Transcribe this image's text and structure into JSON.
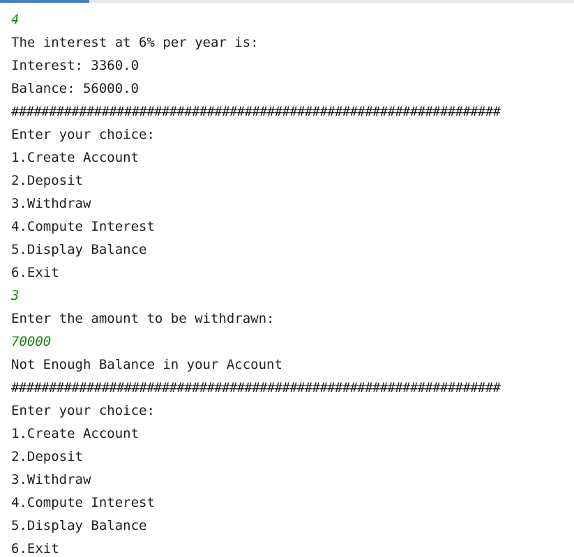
{
  "progress": {
    "fraction": 0.155
  },
  "colors": {
    "input": "#178217",
    "output": "#1f1f1f",
    "progress": "#3d7fd6"
  },
  "console": {
    "lines": [
      {
        "text": "4",
        "type": "input"
      },
      {
        "text": "The interest at 6% per year is:",
        "type": "output"
      },
      {
        "text": "Interest: 3360.0",
        "type": "output"
      },
      {
        "text": "Balance: 56000.0",
        "type": "output"
      },
      {
        "text": "#################################################################",
        "type": "separator"
      },
      {
        "text": "Enter your choice:",
        "type": "output"
      },
      {
        "text": "1.Create Account",
        "type": "output"
      },
      {
        "text": "2.Deposit",
        "type": "output"
      },
      {
        "text": "3.Withdraw",
        "type": "output"
      },
      {
        "text": "4.Compute Interest",
        "type": "output"
      },
      {
        "text": "5.Display Balance",
        "type": "output"
      },
      {
        "text": "6.Exit",
        "type": "output"
      },
      {
        "text": "3",
        "type": "input"
      },
      {
        "text": "Enter the amount to be withdrawn:",
        "type": "output"
      },
      {
        "text": "70000",
        "type": "input"
      },
      {
        "text": "Not Enough Balance in your Account",
        "type": "output"
      },
      {
        "text": "#################################################################",
        "type": "separator"
      },
      {
        "text": "Enter your choice:",
        "type": "output"
      },
      {
        "text": "1.Create Account",
        "type": "output"
      },
      {
        "text": "2.Deposit",
        "type": "output"
      },
      {
        "text": "3.Withdraw",
        "type": "output"
      },
      {
        "text": "4.Compute Interest",
        "type": "output"
      },
      {
        "text": "5.Display Balance",
        "type": "output"
      },
      {
        "text": "6.Exit",
        "type": "output"
      }
    ]
  }
}
